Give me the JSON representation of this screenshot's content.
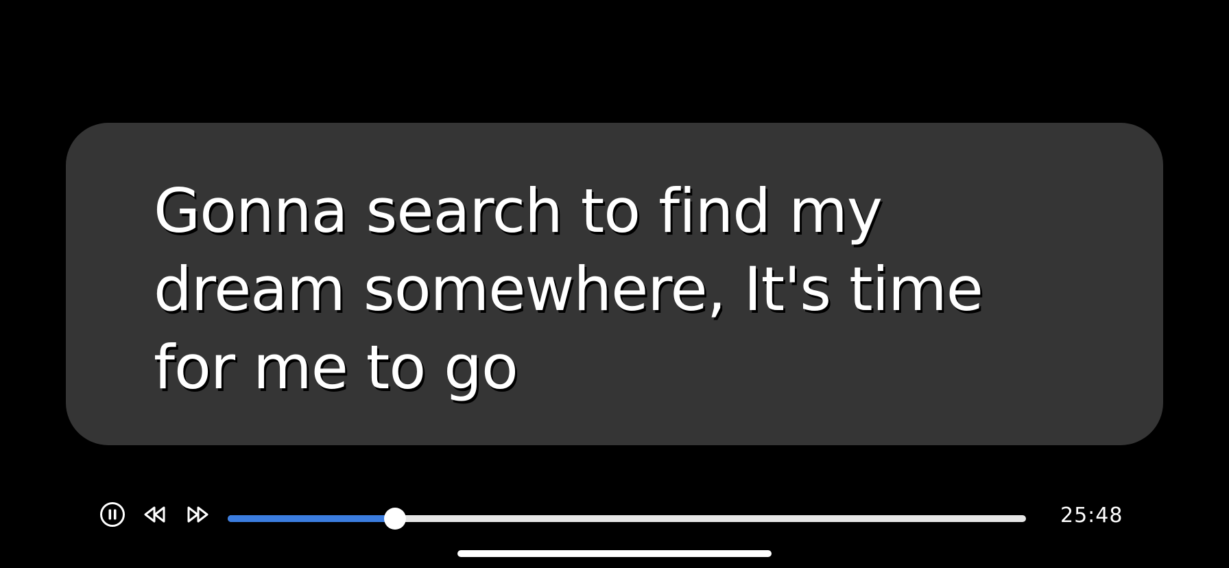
{
  "lyrics": {
    "text": "Gonna search to find my dream somewhere, It's time for me to go"
  },
  "player": {
    "play_state": "playing",
    "pause_icon": "pause-circle-icon",
    "rewind_icon": "rewind-icon",
    "fast_forward_icon": "fast-forward-icon",
    "progress_fraction": 0.21,
    "time": "25:48",
    "accent_color": "#3b7de0"
  }
}
